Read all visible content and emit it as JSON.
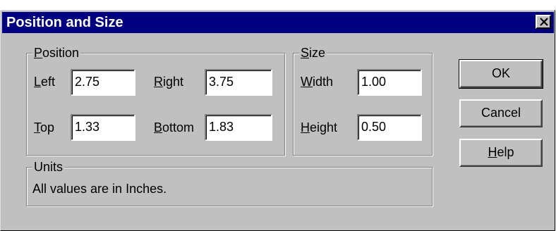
{
  "background_fragment": "g",
  "dialog": {
    "title": "Position and Size"
  },
  "position_group": {
    "legend_prefix": "",
    "legend_mnemonic": "P",
    "legend_rest": "osition",
    "left": {
      "mnemonic": "L",
      "rest": "eft",
      "value": "2.75"
    },
    "right": {
      "mnemonic": "R",
      "rest": "ight",
      "value": "3.75"
    },
    "top": {
      "mnemonic": "T",
      "rest": "op",
      "value": "1.33"
    },
    "bottom": {
      "mnemonic": "B",
      "rest": "ottom",
      "value": "1.83"
    }
  },
  "size_group": {
    "legend_mnemonic": "S",
    "legend_rest": "ize",
    "width": {
      "mnemonic": "W",
      "rest": "idth",
      "value": "1.00"
    },
    "height": {
      "mnemonic": "H",
      "rest": "eight",
      "value": "0.50"
    }
  },
  "units_group": {
    "legend": "Units",
    "text": "All values are in Inches."
  },
  "buttons": {
    "ok": "OK",
    "cancel": "Cancel",
    "help_mnemonic": "H",
    "help_rest": "elp"
  },
  "icons": {
    "close": "close-icon"
  },
  "colors": {
    "titlebar": "#000080",
    "face": "#c0c0c0"
  }
}
